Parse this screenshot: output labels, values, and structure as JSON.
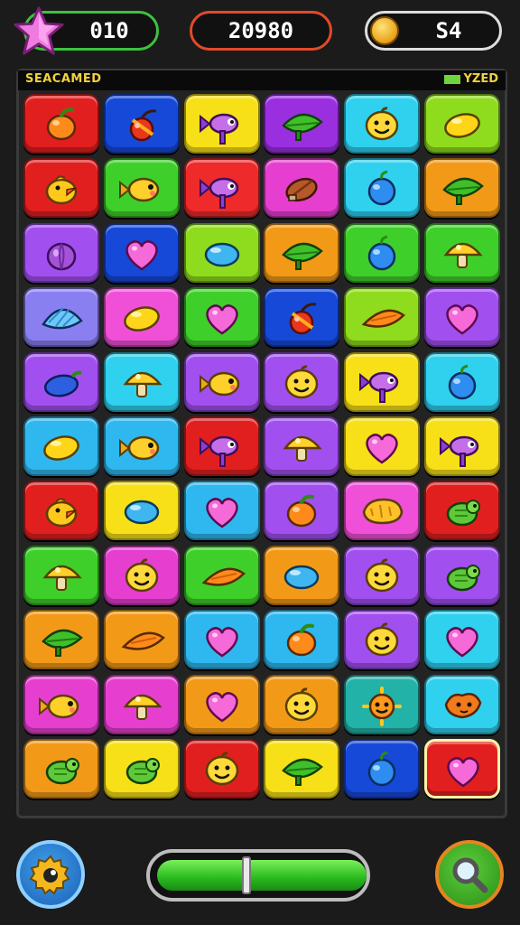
{
  "hud": {
    "moves_label": "010",
    "score_label": "20980",
    "coins_label": "S4"
  },
  "board": {
    "title": "SEACAMED",
    "status_text": "YZED",
    "tiles": [
      [
        {
          "bg": "#e21f1f",
          "icon": "orange-icon"
        },
        {
          "bg": "#1749d8",
          "icon": "cherry-icon"
        },
        {
          "bg": "#f7e018",
          "icon": "candy-fish-icon"
        },
        {
          "bg": "#9a2fe0",
          "icon": "leaf-icon"
        },
        {
          "bg": "#2fd1ef",
          "icon": "smiley-icon"
        },
        {
          "bg": "#8fdc1e",
          "icon": "lemon-icon"
        }
      ],
      [
        {
          "bg": "#e21f1f",
          "icon": "chick-icon"
        },
        {
          "bg": "#3fcf2a",
          "icon": "fish-icon"
        },
        {
          "bg": "#ee2a2a",
          "icon": "candy-fish-icon"
        },
        {
          "bg": "#e63fd0",
          "icon": "nut-icon"
        },
        {
          "bg": "#2fd1ef",
          "icon": "plum-icon"
        },
        {
          "bg": "#f29a18",
          "icon": "leaf-icon"
        }
      ],
      [
        {
          "bg": "#a24ff0",
          "icon": "onion-icon"
        },
        {
          "bg": "#1749d8",
          "icon": "heart-icon"
        },
        {
          "bg": "#8fdc1e",
          "icon": "bean-icon"
        },
        {
          "bg": "#f29a18",
          "icon": "leaf-icon"
        },
        {
          "bg": "#3fcf2a",
          "icon": "plum-icon"
        },
        {
          "bg": "#3fcf2a",
          "icon": "mushroom-icon"
        }
      ],
      [
        {
          "bg": "#8a7ff0",
          "icon": "shell-icon"
        },
        {
          "bg": "#f04fd8",
          "icon": "lemon-icon"
        },
        {
          "bg": "#3fcf2a",
          "icon": "heart-icon"
        },
        {
          "bg": "#1749d8",
          "icon": "cherry-icon"
        },
        {
          "bg": "#8fdc1e",
          "icon": "carrot-icon"
        },
        {
          "bg": "#a24ff0",
          "icon": "heart-icon"
        }
      ],
      [
        {
          "bg": "#a24ff0",
          "icon": "eggplant-icon"
        },
        {
          "bg": "#2fd1ef",
          "icon": "mushroom-icon"
        },
        {
          "bg": "#a24ff0",
          "icon": "fish-icon"
        },
        {
          "bg": "#a24ff0",
          "icon": "smiley-icon"
        },
        {
          "bg": "#f7e018",
          "icon": "candy-fish-icon"
        },
        {
          "bg": "#2fd1ef",
          "icon": "plum-icon"
        }
      ],
      [
        {
          "bg": "#2fb8ef",
          "icon": "lemon-icon"
        },
        {
          "bg": "#2fb8ef",
          "icon": "fish-icon"
        },
        {
          "bg": "#e21f1f",
          "icon": "candy-fish-icon"
        },
        {
          "bg": "#a24ff0",
          "icon": "mushroom-icon"
        },
        {
          "bg": "#f7e018",
          "icon": "heart-icon"
        },
        {
          "bg": "#f7e018",
          "icon": "candy-fish-icon"
        }
      ],
      [
        {
          "bg": "#e21f1f",
          "icon": "chick-icon"
        },
        {
          "bg": "#f7e018",
          "icon": "bean-icon"
        },
        {
          "bg": "#2fb8ef",
          "icon": "heart-icon"
        },
        {
          "bg": "#a24ff0",
          "icon": "orange-icon"
        },
        {
          "bg": "#f04fd8",
          "icon": "bread-icon"
        },
        {
          "bg": "#e21f1f",
          "icon": "turtle-icon"
        }
      ],
      [
        {
          "bg": "#3fcf2a",
          "icon": "mushroom-icon"
        },
        {
          "bg": "#e63fd0",
          "icon": "smiley-icon"
        },
        {
          "bg": "#3fcf2a",
          "icon": "carrot-icon"
        },
        {
          "bg": "#f29a18",
          "icon": "bean-icon"
        },
        {
          "bg": "#a24ff0",
          "icon": "smiley-icon"
        },
        {
          "bg": "#a24ff0",
          "icon": "turtle-icon"
        }
      ],
      [
        {
          "bg": "#f29a18",
          "icon": "leaf-icon"
        },
        {
          "bg": "#f29a18",
          "icon": "carrot-icon"
        },
        {
          "bg": "#2fb8ef",
          "icon": "heart-icon"
        },
        {
          "bg": "#2fb8ef",
          "icon": "orange-icon"
        },
        {
          "bg": "#a24ff0",
          "icon": "smiley-icon"
        },
        {
          "bg": "#2fd1ef",
          "icon": "heart-icon"
        }
      ],
      [
        {
          "bg": "#e63fd0",
          "icon": "fish-icon"
        },
        {
          "bg": "#e63fd0",
          "icon": "mushroom-icon"
        },
        {
          "bg": "#f29a18",
          "icon": "heart-icon"
        },
        {
          "bg": "#f29a18",
          "icon": "smiley-icon"
        },
        {
          "bg": "#22b2a8",
          "icon": "sun-face-icon"
        },
        {
          "bg": "#2fd1ef",
          "icon": "fox-icon"
        }
      ],
      [
        {
          "bg": "#f29a18",
          "icon": "turtle-icon"
        },
        {
          "bg": "#f7e018",
          "icon": "turtle-icon"
        },
        {
          "bg": "#e21f1f",
          "icon": "smiley-icon"
        },
        {
          "bg": "#f7e018",
          "icon": "leaf-icon"
        },
        {
          "bg": "#1749d8",
          "icon": "plum-icon"
        },
        {
          "bg": "#e21f1f",
          "icon": "heart-icon",
          "selected": true
        }
      ]
    ]
  },
  "progress": {
    "value": 0.42
  },
  "colors": {
    "accent_green": "#3cc23c",
    "accent_red": "#e24a2a",
    "coin": "#e8a115"
  },
  "buttons": {
    "left_icon": "gear-icon",
    "right_icon": "magnifier-icon"
  }
}
